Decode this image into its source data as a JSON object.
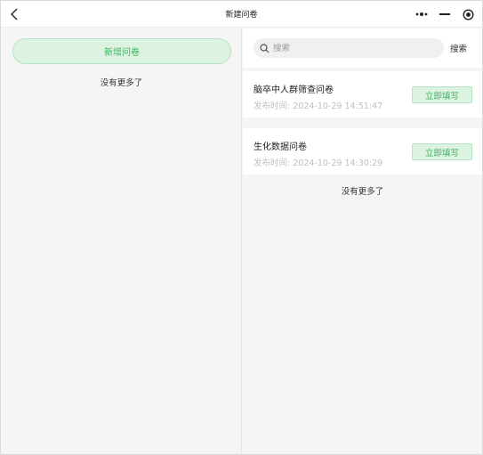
{
  "window": {
    "title": "新建问卷"
  },
  "left": {
    "add_button": "新增问卷",
    "no_more": "没有更多了"
  },
  "search": {
    "placeholder": "搜索",
    "value": "",
    "button": "搜索"
  },
  "surveys": [
    {
      "title": "脑卒中人群筛查问卷",
      "time_label": "发布时间:",
      "time": "2024-10-29 14:51:47",
      "action": "立即填写"
    },
    {
      "title": "生化数据问卷",
      "time_label": "发布时间:",
      "time": "2024-10-29 14:30:29",
      "action": "立即填写"
    }
  ],
  "right": {
    "no_more": "没有更多了"
  },
  "colors": {
    "accent": "#3bb55e",
    "accent_bg": "#dcf3e2",
    "accent_border": "#b7e2c3"
  },
  "icons": {
    "back": "chevron-left-icon",
    "more": "more-dots-icon",
    "minimize": "minimize-icon",
    "close": "target-close-icon",
    "search": "search-icon"
  }
}
